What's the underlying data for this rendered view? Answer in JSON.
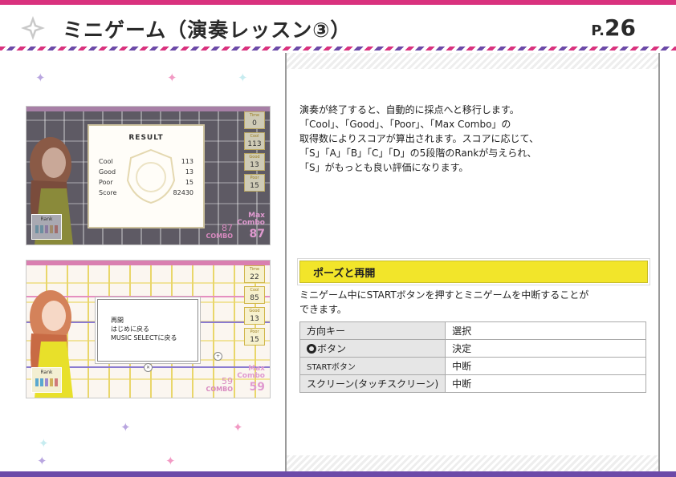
{
  "header": {
    "title": "ミニゲーム（演奏レッスン③）",
    "page_prefix": "P.",
    "page_number": "26"
  },
  "screenshot1": {
    "result_title": "RESULT",
    "rows": [
      {
        "label": "Cool",
        "value": "113"
      },
      {
        "label": "Good",
        "value": "13"
      },
      {
        "label": "Poor",
        "value": "15"
      },
      {
        "label": "Score",
        "value": "82430"
      }
    ],
    "stats": [
      {
        "label": "Time",
        "value": "0"
      },
      {
        "label": "Cool",
        "value": "113"
      },
      {
        "label": "Good",
        "value": "13"
      },
      {
        "label": "Poor",
        "value": "15"
      }
    ],
    "rank_label": "Rank",
    "combo_value": "87",
    "combo_label": "COMBO",
    "max_combo_label": "Max\nCombo",
    "max_combo_value": "87"
  },
  "screenshot2": {
    "menu": [
      "再開",
      "はじめに戻る",
      "MUSIC SELECTに戻る"
    ],
    "stats": [
      {
        "label": "Time",
        "value": "22"
      },
      {
        "label": "Cool",
        "value": "85"
      },
      {
        "label": "Good",
        "value": "13"
      },
      {
        "label": "Poor",
        "value": "15"
      }
    ],
    "rank_label": "Rank",
    "combo_value": "59",
    "combo_label": "COMBO",
    "max_combo_label": "Max\nCombo",
    "max_combo_value": "59"
  },
  "description": {
    "lines": [
      "演奏が終了すると、自動的に採点へと移行します。",
      "「Cool」、「Good」、「Poor」、「Max Combo」の",
      "取得数によりスコアが算出されます。スコアに応じて、",
      "「S」「A」「B」「C」「D」の5段階のRankが与えられ、",
      "「S」がもっとも良い評価になります。"
    ]
  },
  "pause_section": {
    "heading": "ポーズと再開",
    "desc_lines": [
      "ミニゲーム中にSTARTボタンを押すとミニゲームを中断することが",
      "できます。"
    ],
    "controls": [
      {
        "key": "方向キー",
        "action": "選択"
      },
      {
        "key": "ボタン",
        "action": "決定",
        "icon": "circle-button-icon"
      },
      {
        "key": "STARTボタン",
        "action": "中断"
      },
      {
        "key": "スクリーン(タッチスクリーン)",
        "action": "中断"
      }
    ]
  },
  "colors": {
    "magenta": "#d9327e",
    "purple": "#6c4aa8",
    "yellow_heading": "#f2e52a"
  }
}
